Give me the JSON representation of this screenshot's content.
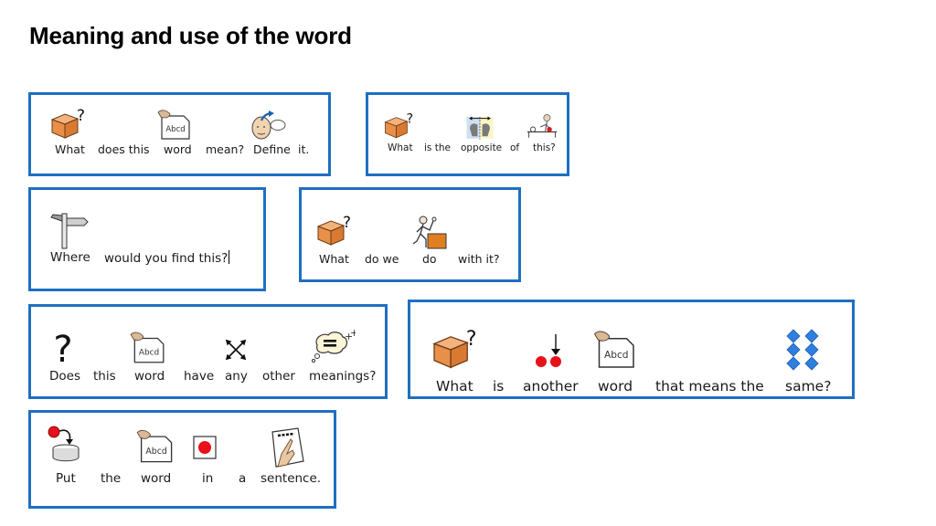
{
  "page": {
    "title": "Meaning and use of the word"
  },
  "colors": {
    "card_border": "#1f6fc1",
    "box_orange": "#e8904a",
    "red_dot": "#e8101a",
    "diamond_blue": "#2f7fe0"
  },
  "cards": [
    {
      "id": "define",
      "words": [
        {
          "text": "What",
          "icon": "box-question-icon"
        },
        {
          "text": "does this",
          "icon": null
        },
        {
          "text": "word",
          "icon": "word-card-icon"
        },
        {
          "text": "mean?",
          "icon": null
        },
        {
          "text": "Define",
          "icon": "think-face-icon"
        },
        {
          "text": "it.",
          "icon": null
        }
      ]
    },
    {
      "id": "opposite",
      "words": [
        {
          "text": "What",
          "icon": "box-question-icon"
        },
        {
          "text": "is the",
          "icon": null
        },
        {
          "text": "opposite",
          "icon": "opposite-heads-icon"
        },
        {
          "text": "of",
          "icon": null
        },
        {
          "text": "this?",
          "icon": "person-pointing-table-icon"
        }
      ]
    },
    {
      "id": "where",
      "words": [
        {
          "text": "Where",
          "icon": "signpost-icon"
        },
        {
          "text": "would you find this?",
          "icon": null
        }
      ]
    },
    {
      "id": "what-do",
      "words": [
        {
          "text": "What",
          "icon": "box-question-icon"
        },
        {
          "text": "do we",
          "icon": null
        },
        {
          "text": "do",
          "icon": "person-doing-box-icon"
        },
        {
          "text": "with it?",
          "icon": null
        }
      ]
    },
    {
      "id": "other-meanings",
      "words": [
        {
          "text": "Does",
          "icon": "question-mark-icon"
        },
        {
          "text": "this",
          "icon": null
        },
        {
          "text": "word",
          "icon": "word-card-icon"
        },
        {
          "text": "have",
          "icon": null
        },
        {
          "text": "any",
          "icon": "arrows-outward-icon"
        },
        {
          "text": "other",
          "icon": null
        },
        {
          "text": "meanings?",
          "icon": "thought-bubble-equals-icon"
        }
      ]
    },
    {
      "id": "synonym",
      "words": [
        {
          "text": "What",
          "icon": "box-question-icon"
        },
        {
          "text": "is",
          "icon": null
        },
        {
          "text": "another",
          "icon": "another-dots-icon"
        },
        {
          "text": "word",
          "icon": "word-card-icon"
        },
        {
          "text": "that means the",
          "icon": null
        },
        {
          "text": "same?",
          "icon": "same-diamonds-icon"
        }
      ]
    },
    {
      "id": "sentence",
      "words": [
        {
          "text": "Put",
          "icon": "put-in-icon"
        },
        {
          "text": "the",
          "icon": null
        },
        {
          "text": "word",
          "icon": "word-card-icon"
        },
        {
          "text": "in",
          "icon": "in-box-icon"
        },
        {
          "text": "a",
          "icon": null
        },
        {
          "text": "sentence.",
          "icon": "sentence-page-icon"
        }
      ]
    }
  ],
  "word_card_label": "Abcd"
}
